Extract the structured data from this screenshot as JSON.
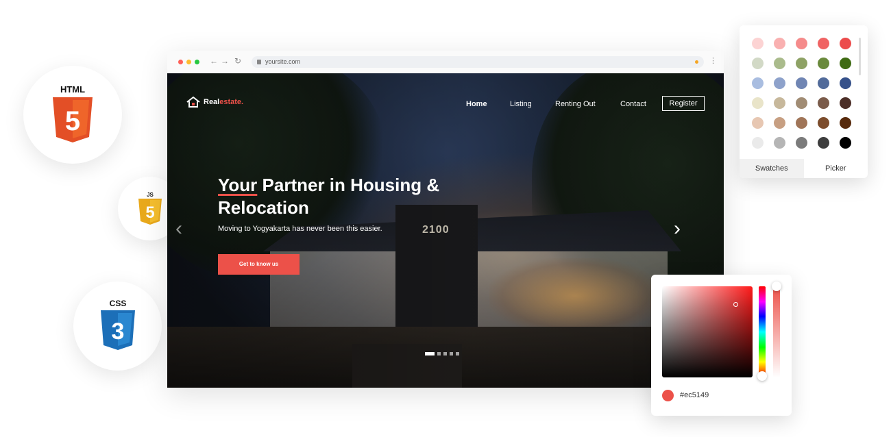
{
  "badges": {
    "html": "HTML",
    "js": "JS",
    "css": "CSS",
    "html_num": "5",
    "js_num": "5",
    "css_num": "3"
  },
  "browser": {
    "url": "yoursite.com",
    "dots": [
      "#ff5f57",
      "#febc2e",
      "#28c840"
    ]
  },
  "site": {
    "logo_main": "Real",
    "logo_accent": "estate.",
    "nav": [
      "Home",
      "Listing",
      "Renting Out",
      "Contact"
    ],
    "register": "Register",
    "headline_highlight": "Your",
    "headline_rest": " Partner in Housing & Relocation",
    "subheadline": "Moving to Yogyakarta has never been this easier.",
    "cta": "Get to know us",
    "building_sign": "2100",
    "slide_count": 5,
    "active_slide": 1
  },
  "swatches_panel": {
    "colors": [
      "#fcd3d3",
      "#f9b0b0",
      "#f58b8b",
      "#f06464",
      "#ec4c4c",
      "#d2d9c6",
      "#aabb8c",
      "#8ea265",
      "#6a8a3c",
      "#3f6b14",
      "#a9bde0",
      "#8ea2cb",
      "#7085b3",
      "#526b9a",
      "#36518a",
      "#e9e4c9",
      "#c7b89b",
      "#a18c74",
      "#7a5b4a",
      "#4c2f28",
      "#e7c7b2",
      "#c79f82",
      "#a07558",
      "#7c4c2c",
      "#572a0c",
      "#eaeaea",
      "#b5b5b5",
      "#7b7b7b",
      "#3d3d3d",
      "#000000"
    ],
    "tabs": [
      "Swatches",
      "Picker"
    ],
    "active_tab": "Swatches"
  },
  "picker_panel": {
    "hex": "#ec5149",
    "current_color": "#ec5149"
  },
  "theme": {
    "accent": "#ec5149"
  }
}
